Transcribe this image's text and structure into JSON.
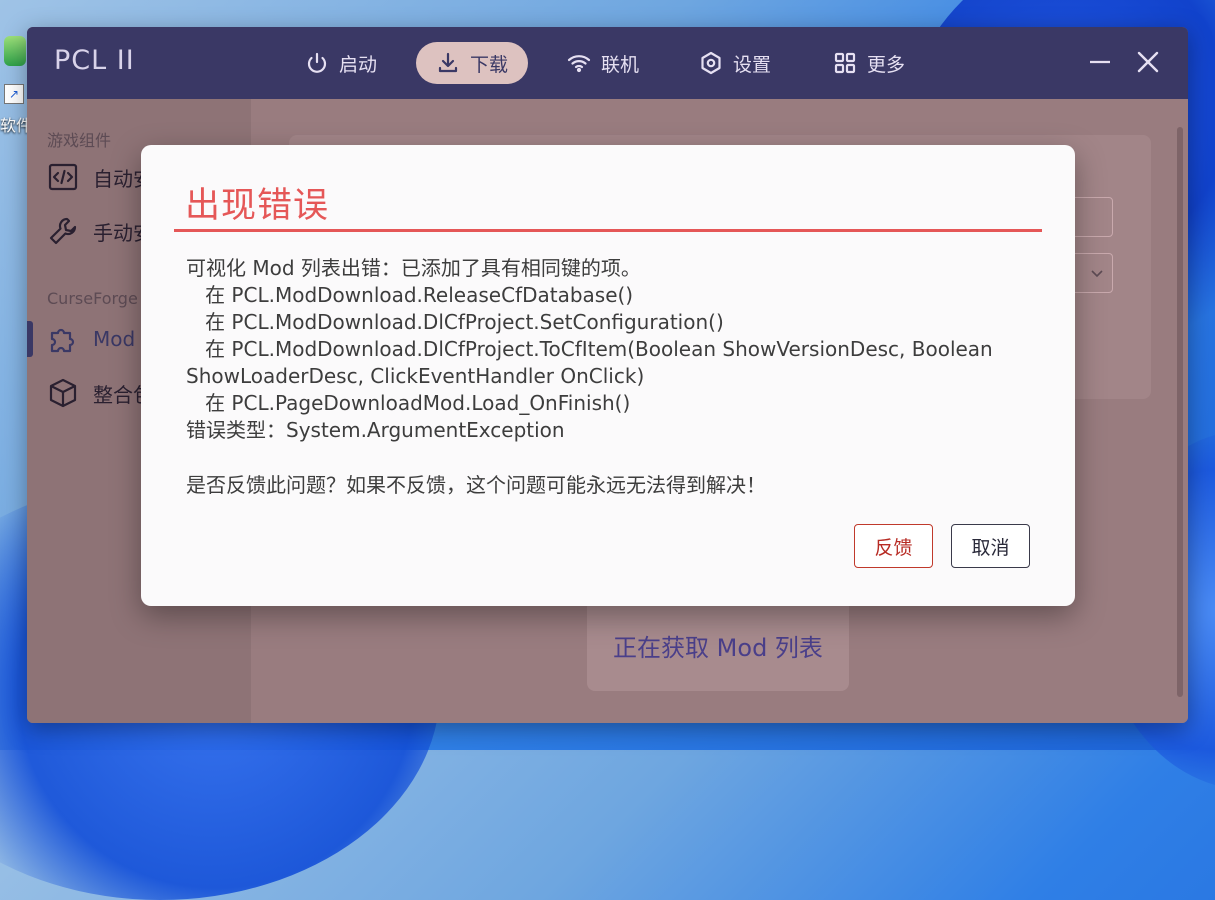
{
  "desktop": {
    "icon_label": "软件"
  },
  "app": {
    "logo": "PCL II",
    "nav": [
      {
        "label": "启动",
        "icon": "power-icon"
      },
      {
        "label": "下载",
        "icon": "download-icon",
        "active": true
      },
      {
        "label": "联机",
        "icon": "wifi-icon"
      },
      {
        "label": "设置",
        "icon": "settings-icon"
      },
      {
        "label": "更多",
        "icon": "grid-icon"
      }
    ]
  },
  "sidebar": {
    "section1": "游戏组件",
    "items1": [
      {
        "label": "自动安",
        "icon": "code-icon"
      },
      {
        "label": "手动安",
        "icon": "wrench-icon"
      }
    ],
    "section2": "CurseForge",
    "items2": [
      {
        "label": "Mod",
        "icon": "puzzle-icon",
        "active": true
      },
      {
        "label": "整合包",
        "icon": "cube-icon"
      }
    ]
  },
  "content": {
    "loading": "正在获取 Mod 列表"
  },
  "dialog": {
    "title": "出现错误",
    "lines": [
      "可视化 Mod 列表出错：已添加了具有相同键的项。",
      "   在 PCL.ModDownload.ReleaseCfDatabase()",
      "   在 PCL.ModDownload.DlCfProject.SetConfiguration()",
      "   在 PCL.ModDownload.DlCfProject.ToCfItem(Boolean ShowVersionDesc, Boolean ShowLoaderDesc, ClickEventHandler OnClick)",
      "   在 PCL.PageDownloadMod.Load_OnFinish()",
      "错误类型：System.ArgumentException"
    ],
    "question": "是否反馈此问题？如果不反馈，这个问题可能永远无法得到解决！",
    "feedback_label": "反馈",
    "cancel_label": "取消"
  }
}
